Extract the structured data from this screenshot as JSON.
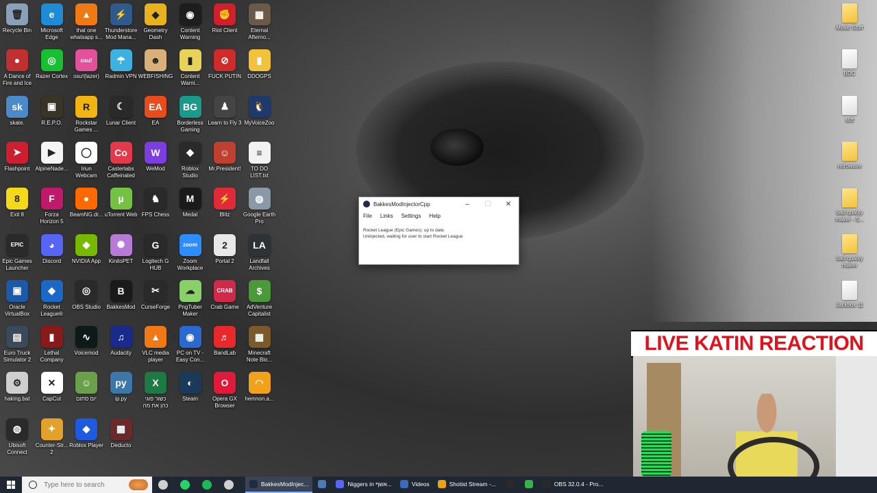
{
  "desktop": {
    "icons": [
      {
        "label": "Recycle Bin",
        "glyph": "🗑",
        "color": "#8aa0b8"
      },
      {
        "label": "Microsoft\nEdge",
        "glyph": "e",
        "color": "#1f8ad6"
      },
      {
        "label": "that one\nwhatsapp s...",
        "glyph": "▲",
        "color": "#ef7a15"
      },
      {
        "label": "Thunderstore\nMod Mana...",
        "glyph": "⚡",
        "color": "#2f5a8c"
      },
      {
        "label": "Geometry\nDash",
        "glyph": "◆",
        "color": "#e8b21c"
      },
      {
        "label": "Content\nWarning",
        "glyph": "◉",
        "color": "#1d1d1d"
      },
      {
        "label": "Riot Client",
        "glyph": "✊",
        "color": "#d0202c"
      },
      {
        "label": "Eternal\nAfterno...",
        "glyph": "▦",
        "color": "#6b5a4a"
      },
      {
        "label": "A Dance of\nFire and Ice",
        "glyph": "●",
        "color": "#c03030"
      },
      {
        "label": "Razer Cortex",
        "glyph": "◎",
        "color": "#17c030"
      },
      {
        "label": "osu!(lazer)",
        "glyph": "osu!",
        "color": "#e5509a"
      },
      {
        "label": "Radmin VPN",
        "glyph": "☂",
        "color": "#3db1e0"
      },
      {
        "label": "WEBFISHING",
        "glyph": "☻",
        "color": "#d9b07a"
      },
      {
        "label": "Content\nWarni...",
        "glyph": "▮",
        "color": "#e8d35a"
      },
      {
        "label": "FUCK PUTIN",
        "glyph": "⊘",
        "color": "#d02a2a"
      },
      {
        "label": "DDOGPS",
        "glyph": "▮",
        "color": "#f3c23d"
      },
      {
        "label": "skate.",
        "glyph": "sk",
        "color": "#4a8ac8"
      },
      {
        "label": "R.E.P.O.",
        "glyph": "▣",
        "color": "#3a3426"
      },
      {
        "label": "Rockstar\nGames ...",
        "glyph": "R",
        "color": "#f1b412"
      },
      {
        "label": "Lunar Client",
        "glyph": "☾",
        "color": "#2a2a2a"
      },
      {
        "label": "EA",
        "glyph": "EA",
        "color": "#e84b1c"
      },
      {
        "label": "Borderless\nGaming",
        "glyph": "BG",
        "color": "#1a9a8a"
      },
      {
        "label": "Learn to Fly 3",
        "glyph": "♟",
        "color": "#444444"
      },
      {
        "label": "MyVoiceZoo",
        "glyph": "🐧",
        "color": "#1e3a6a"
      },
      {
        "label": "Flashpoint",
        "glyph": "➤",
        "color": "#cc2030"
      },
      {
        "label": "AlpineNade...",
        "glyph": "▶",
        "color": "#f4f4f4"
      },
      {
        "label": "Iriun\nWebcam",
        "glyph": "◯",
        "color": "#ffffff"
      },
      {
        "label": "Casterlabs\nCaffeinated",
        "glyph": "Co",
        "color": "#e23a4a"
      },
      {
        "label": "WeMod",
        "glyph": "W",
        "color": "#7b3fe0"
      },
      {
        "label": "Roblox\nStudio",
        "glyph": "◆",
        "color": "#2a2a2a"
      },
      {
        "label": "Mr.President!",
        "glyph": "☺",
        "color": "#c04030"
      },
      {
        "label": "TO DO\nLIST.txt",
        "glyph": "≡",
        "color": "#f2f2f2"
      },
      {
        "label": "Exit 8",
        "glyph": "8",
        "color": "#f4d81a"
      },
      {
        "label": "Forza\nHorizon 5",
        "glyph": "F",
        "color": "#c0186a"
      },
      {
        "label": "BeamNG.dr...",
        "glyph": "●",
        "color": "#ff6a00"
      },
      {
        "label": "uTorrent Web",
        "glyph": "µ",
        "color": "#76c043"
      },
      {
        "label": "FPS Chess",
        "glyph": "♞",
        "color": "#2a2a2a"
      },
      {
        "label": "Medal",
        "glyph": "M",
        "color": "#1a1a1a"
      },
      {
        "label": "Blitz",
        "glyph": "⚡",
        "color": "#e02a3a"
      },
      {
        "label": "Google Earth\nPro",
        "glyph": "◍",
        "color": "#8a98a8"
      },
      {
        "label": "Epic Games\nLauncher",
        "glyph": "EPIC",
        "color": "#2a2a2a"
      },
      {
        "label": "Discord",
        "glyph": "◕",
        "color": "#5865f2"
      },
      {
        "label": "NVIDIA App",
        "glyph": "◈",
        "color": "#76b900"
      },
      {
        "label": "KinitoPET",
        "glyph": "✺",
        "color": "#b77ad6"
      },
      {
        "label": "Logitech G\nHUB",
        "glyph": "G",
        "color": "#2a2a2a"
      },
      {
        "label": "Zoom\nWorkplace",
        "glyph": "zoom",
        "color": "#2d8cff"
      },
      {
        "label": "Portal 2",
        "glyph": "2",
        "color": "#e8e8e8"
      },
      {
        "label": "Landfall\nArchives",
        "glyph": "LA",
        "color": "#2c3236"
      },
      {
        "label": "Oracle\nVirtualBox",
        "glyph": "▣",
        "color": "#1a5aa8"
      },
      {
        "label": "Rocket\nLeague®",
        "glyph": "◆",
        "color": "#1b68c7"
      },
      {
        "label": "OBS Studio",
        "glyph": "◎",
        "color": "#2a2a2a"
      },
      {
        "label": "BakkesMod",
        "glyph": "B",
        "color": "#1a1a1a"
      },
      {
        "label": "CurseForge",
        "glyph": "✂",
        "color": "#2a2a2a"
      },
      {
        "label": "PngTuber\nMaker",
        "glyph": "☁",
        "color": "#8ad06a"
      },
      {
        "label": "Crab Game",
        "glyph": "CRAB",
        "color": "#d02a4a"
      },
      {
        "label": "AdVenture\nCapitalist",
        "glyph": "$",
        "color": "#4a9a3a"
      },
      {
        "label": "Euro Truck\nSimulator 2",
        "glyph": "▤",
        "color": "#3a4a5a"
      },
      {
        "label": "Lethal\nCompany",
        "glyph": "▮",
        "color": "#8a1a1a"
      },
      {
        "label": "Voicemod",
        "glyph": "∿",
        "color": "#0e1a1a"
      },
      {
        "label": "Audacity",
        "glyph": "♫",
        "color": "#1a2a8a"
      },
      {
        "label": "VLC media\nplayer",
        "glyph": "▲",
        "color": "#ef7a15"
      },
      {
        "label": "PC on TV -\nEasy Con...",
        "glyph": "◉",
        "color": "#2a6ad0"
      },
      {
        "label": "BandLab",
        "glyph": "♬",
        "color": "#e8282a"
      },
      {
        "label": "Minecraft\nNote Blo...",
        "glyph": "▦",
        "color": "#7a5a2a"
      },
      {
        "label": "haking.bat",
        "glyph": "⚙",
        "color": "#cfcfcf"
      },
      {
        "label": "CapCut",
        "glyph": "✕",
        "color": "#ffffff"
      },
      {
        "label": "יום סתום",
        "glyph": "☺",
        "color": "#6aa04a"
      },
      {
        "label": "ip.py",
        "glyph": "py",
        "color": "#3b77a8"
      },
      {
        "label": "כשור פוגי\nכהן את מה",
        "glyph": "X",
        "color": "#1e7a45"
      },
      {
        "label": "Steam",
        "glyph": "◐",
        "color": "#1b3a5a"
      },
      {
        "label": "Opera GX\nBrowser",
        "glyph": "O",
        "color": "#e01a3a"
      },
      {
        "label": "hemnon.a...",
        "glyph": "◠",
        "color": "#f1a21a"
      },
      {
        "label": "Ubisoft\nConnect",
        "glyph": "◍",
        "color": "#2a2a2a"
      },
      {
        "label": "Counter-Str...\n2",
        "glyph": "✦",
        "color": "#e1a12a"
      },
      {
        "label": "Roblox Player",
        "glyph": "◆",
        "color": "#1e5ae0"
      },
      {
        "label": "Deducto",
        "glyph": "▦",
        "color": "#6a2a2a"
      }
    ],
    "right_icons": [
      {
        "label": "Music Stuff",
        "kind": "folder"
      },
      {
        "label": "BDC",
        "kind": "white"
      },
      {
        "label": "stiff",
        "kind": "white"
      },
      {
        "label": "retrowave",
        "kind": "folder"
      },
      {
        "label": "bad quality\nmaker - S...",
        "kind": "folder"
      },
      {
        "label": "bad quality\nmaker",
        "kind": "folder"
      },
      {
        "label": "Jackbox 11",
        "kind": "white"
      }
    ]
  },
  "injector_window": {
    "title": "BakkesModInjectorCpp",
    "minimize": "–",
    "maximize": "☐",
    "close": "✕",
    "menu": [
      "File",
      "Links",
      "Settings",
      "Help"
    ],
    "status_line1": "Rocket League (Epic Games): up to date.",
    "status_line2": "Uninjected, waiting for user to start Rocket League"
  },
  "overlay": {
    "title": "LIVE KATIN REACTION"
  },
  "taskbar": {
    "search_placeholder": "Type here to search",
    "apps": [
      {
        "label": "BakkesModInjec...",
        "color": "#1f2a44",
        "active": true
      },
      {
        "label": "",
        "color": "#4a7ab8",
        "active": false
      },
      {
        "label": "Niggers in אשף...",
        "color": "#5865f2",
        "active": false
      },
      {
        "label": "Videos",
        "color": "#3a6ab8",
        "active": false
      },
      {
        "label": "Shotist Stream -...",
        "color": "#e8a21a",
        "active": false
      },
      {
        "label": "",
        "color": "#2a2a2a",
        "active": false
      },
      {
        "label": "",
        "color": "#37b24d",
        "active": false
      },
      {
        "label": "OBS 32.0.4 - Pro...",
        "color": "#2a2a2a",
        "active": false
      }
    ],
    "pinned": [
      {
        "name": "task-view-icon",
        "color": "#cfcfcf"
      },
      {
        "name": "whatsapp-icon",
        "color": "#25d366"
      },
      {
        "name": "spotify-icon",
        "color": "#1db954"
      },
      {
        "name": "settings-icon",
        "color": "#cfcfcf"
      }
    ]
  }
}
